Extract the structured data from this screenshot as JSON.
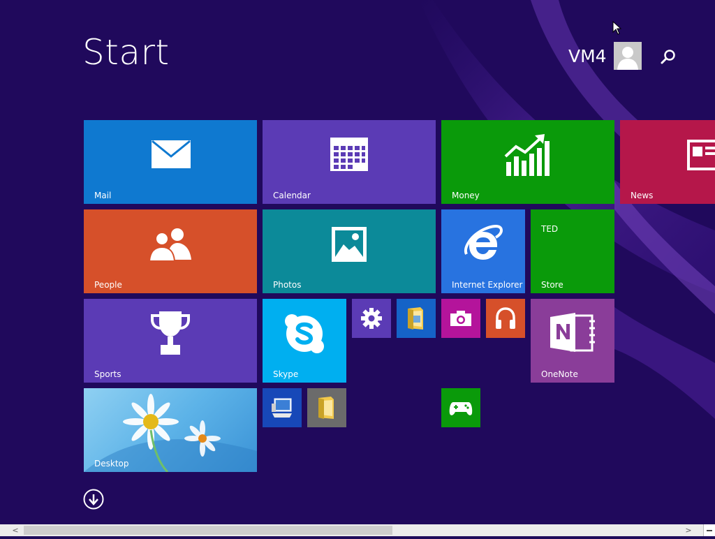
{
  "header": {
    "title": "Start",
    "user_name": "VM4",
    "user_icon": "user-icon",
    "search_icon": "search-icon"
  },
  "tiles": {
    "mail": {
      "label": "Mail",
      "icon": "mail-icon",
      "color": "#0f79d0"
    },
    "calendar": {
      "label": "Calendar",
      "icon": "calendar-icon",
      "color": "#5b3bb5"
    },
    "money": {
      "label": "Money",
      "icon": "chart-icon",
      "color": "#0a9a0a"
    },
    "news": {
      "label": "News",
      "icon": "newspaper-icon",
      "color": "#b5174a"
    },
    "people": {
      "label": "People",
      "icon": "people-icon",
      "color": "#d6502a"
    },
    "photos": {
      "label": "Photos",
      "icon": "photo-icon",
      "color": "#0c8a99"
    },
    "ie": {
      "label": "Internet Explorer",
      "icon": "internet-explorer-icon",
      "color": "#2873e0"
    },
    "store": {
      "label": "Store",
      "badge": "TED",
      "icon": "store-icon",
      "color": "#0a9a0a"
    },
    "sports": {
      "label": "Sports",
      "icon": "trophy-icon",
      "color": "#5b3bb5"
    },
    "skype": {
      "label": "Skype",
      "icon": "skype-icon",
      "color": "#00aff0"
    },
    "settings": {
      "icon": "gear-icon",
      "color": "#5b3bb5"
    },
    "file_explorer": {
      "icon": "file-explorer-icon",
      "color": "#1563c7"
    },
    "camera": {
      "icon": "camera-icon",
      "color": "#b4149b"
    },
    "music": {
      "icon": "headphones-icon",
      "color": "#d6502a"
    },
    "onenote": {
      "label": "OneNote",
      "icon": "onenote-icon",
      "color": "#8a3d99"
    },
    "desktop": {
      "label": "Desktop",
      "icon": "desktop-wallpaper"
    },
    "this_pc": {
      "icon": "computer-icon",
      "color": "#1748b8"
    },
    "documents": {
      "icon": "folder-icon",
      "color": "#6b6b6b"
    },
    "games": {
      "icon": "xbox-controller-icon",
      "color": "#0a9a0a"
    }
  },
  "footer": {
    "scroll_down_icon": "arrow-down-circle-icon"
  },
  "scrollbar": {
    "left_arrow": "<",
    "right_arrow": ">"
  }
}
